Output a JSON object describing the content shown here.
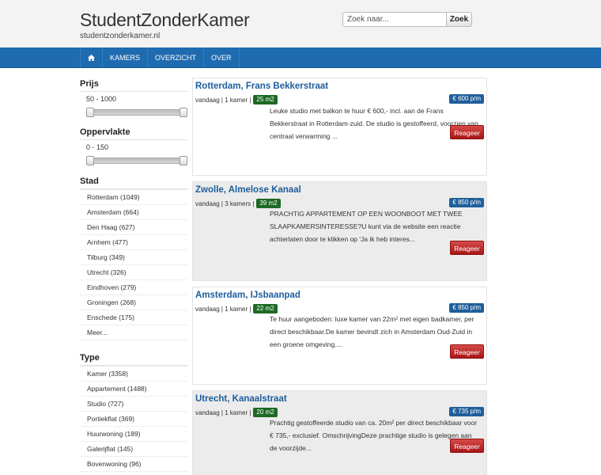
{
  "header": {
    "title": "StudentZonderKamer",
    "subtitle": "studentzonderkamer.nl",
    "search_placeholder": "Zoek naar...",
    "search_button": "Zoek"
  },
  "nav": {
    "home_icon": "home-icon",
    "items": [
      "KAMERS",
      "OVERZICHT",
      "OVER"
    ]
  },
  "sidebar": {
    "prijs": {
      "heading": "Prijs",
      "range_label": "50 - 1000",
      "min": 0,
      "max": 1
    },
    "oppervlakte": {
      "heading": "Oppervlakte",
      "range_label": "0 - 150",
      "min": 0,
      "max": 1
    },
    "stad": {
      "heading": "Stad",
      "items": [
        "Rotterdam (1049)",
        "Amsterdam (664)",
        "Den Haag (627)",
        "Arnhem (477)",
        "Tilburg (349)",
        "Utrecht (326)",
        "Eindhoven (279)",
        "Groningen (268)",
        "Enschede (175)",
        "Meer..."
      ]
    },
    "type": {
      "heading": "Type",
      "items": [
        "Kamer (3358)",
        "Appartement (1488)",
        "Studio (727)",
        "Portiekflat (369)",
        "Huurwoning (189)",
        "Galerijflat (145)",
        "Bovenwoning (96)"
      ]
    }
  },
  "listings": [
    {
      "title": "Rotterdam, Frans Bekkerstraat",
      "price": "€ 600 p/m",
      "meta": "vandaag | 1 kamer |",
      "size": "25 m2",
      "description": "Leuke studio met balkon te huur € 600,- incl. aan de Frans Bekkerstraat in Rotterdam-zuid. De studio is gestoffeerd, voorzien van centraal verwarming ...",
      "button": "Reageer"
    },
    {
      "title": "Zwolle, Almelose Kanaal",
      "price": "€ 850 p/m",
      "meta": "vandaag | 3 kamers |",
      "size": "39 m2",
      "description": "PRACHTIG APPARTEMENT OP EEN WOONBOOT MET TWEE SLAAPKAMERSINTERESSE?U kunt via de website een reactie achterlaten door te klikken op 'Ja ik heb interes...",
      "button": "Reageer"
    },
    {
      "title": "Amsterdam, IJsbaanpad",
      "price": "€ 850 p/m",
      "meta": "vandaag | 1 kamer |",
      "size": "22 m2",
      "description": "Te huur aangeboden: luxe kamer van 22m² met eigen badkamer, per direct beschikbaar.De kamer bevindt zich in Amsterdam Oud-Zuid in een groene omgeving....",
      "button": "Reageer"
    },
    {
      "title": "Utrecht, Kanaalstraat",
      "price": "€ 735 p/m",
      "meta": "vandaag | 1 kamer |",
      "size": "20 m2",
      "description": "Prachtig gestoffeerde studio van ca. 20m² per direct beschikbaar voor € 735,- exclusief. OmschrijvingDeze prachtige studio is gelegen aan de voorzijde...",
      "button": "Reageer"
    }
  ]
}
